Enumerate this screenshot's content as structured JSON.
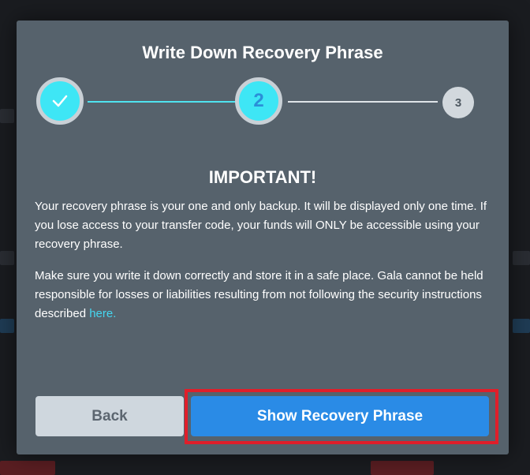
{
  "modal": {
    "title": "Write Down Recovery Phrase",
    "steps": [
      {
        "label": "✓",
        "state": "complete"
      },
      {
        "label": "2",
        "state": "active"
      },
      {
        "label": "3",
        "state": "inactive"
      }
    ],
    "heading": "IMPORTANT!",
    "paragraph_1": "Your recovery phrase is your one and only backup. It will be displayed only one time. If you lose access to your transfer code, your funds will ONLY be accessible using your recovery phrase.",
    "paragraph_2_text": "Make sure you write it down correctly and store it in a safe place. Gala cannot be held responsible for losses or liabilities resulting from not following the security instructions described ",
    "paragraph_2_link": "here.",
    "back_label": "Back",
    "show_label": "Show Recovery Phrase"
  },
  "colors": {
    "modal_bg": "#56626c",
    "accent_cyan": "#3ee6f5",
    "primary_blue": "#2a8be6",
    "highlight_red": "#e01e2a"
  }
}
